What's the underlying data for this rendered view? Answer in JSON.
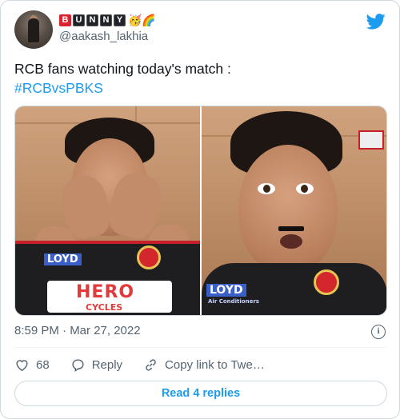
{
  "author": {
    "display_letters": [
      "B",
      "U",
      "N",
      "N",
      "Y"
    ],
    "display_emojis": "🥳🌈",
    "handle": "@aakash_lakhia"
  },
  "tweet": {
    "text": "RCB fans watching today's match :",
    "hashtag": "#RCBvsPBKS"
  },
  "media": {
    "left_panel": {
      "sponsor_1": "LOYD",
      "sponsor_2": "HERO",
      "sponsor_3": "CYCLES"
    },
    "right_panel": {
      "sponsor_1": "LOYD",
      "sponsor_2": "Air Conditioners"
    }
  },
  "meta": {
    "timestamp": "8:59 PM · Mar 27, 2022"
  },
  "actions": {
    "like_count": "68",
    "reply_label": "Reply",
    "copy_label": "Copy link to Twe…"
  },
  "footer": {
    "read_replies": "Read 4 replies"
  },
  "colors": {
    "accent": "#1d9bf0",
    "text": "#0f1419",
    "muted": "#536471",
    "border": "#cfd9de"
  }
}
